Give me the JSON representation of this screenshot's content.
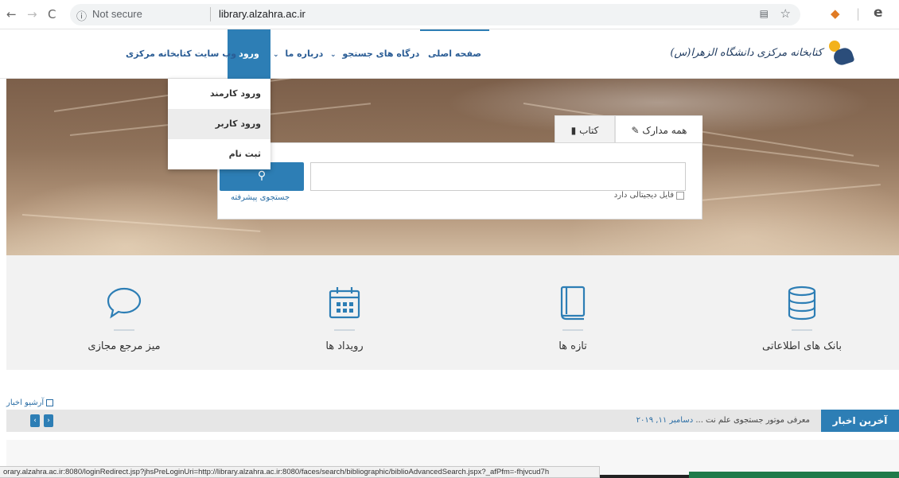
{
  "browser": {
    "back_icon": "arrow-left",
    "forward_icon": "arrow-right",
    "reload_icon": "reload",
    "security_label": "Not secure",
    "url": "library.alzahra.ac.ir"
  },
  "header": {
    "logo_text": "کتابخانه مرکزی دانشگاه الزهرا(س)",
    "nav": {
      "home": "صفحه اصلی",
      "search_portals": "درگاه های جستجو",
      "about": "درباره ما",
      "login": "ورود",
      "website": "وب سایت کتابخانه مرکزی"
    }
  },
  "login_dropdown": {
    "items": [
      "ورود کارمند",
      "ورود کاربر",
      "ثبت نام"
    ]
  },
  "search": {
    "tabs": {
      "all_docs": "همه مدارک",
      "book": "کتاب"
    },
    "button_icon": "search",
    "advanced": "جستجوی پیشرفته",
    "has_digital_file": "فایل دیجیتالی دارد"
  },
  "features": [
    {
      "label": "بانک های اطلاعاتی",
      "icon": "database-icon"
    },
    {
      "label": "تازه ها",
      "icon": "book-icon"
    },
    {
      "label": "رویداد ها",
      "icon": "calendar-icon"
    },
    {
      "label": "میز مرجع مجازی",
      "icon": "chat-icon"
    }
  ],
  "news": {
    "archive_label": "آرشیو اخبار",
    "title": "آخرین اخبار",
    "headline": "معرفی موتور جستجوی علم نت ...",
    "date": "دسامبر ۱۱, ۲۰۱۹"
  },
  "status_bar": {
    "url": "orary.alzahra.ac.ir:8080/loginRedirect.jsp?jhsPreLoginUri=http://library.alzahra.ac.ir:8080/faces/search/bibliographic/biblioAdvancedSearch.jspx?_afPfm=-fhjvcud7h"
  },
  "colors": {
    "accent": "#2d7eb5",
    "link": "#2b6ea5"
  }
}
